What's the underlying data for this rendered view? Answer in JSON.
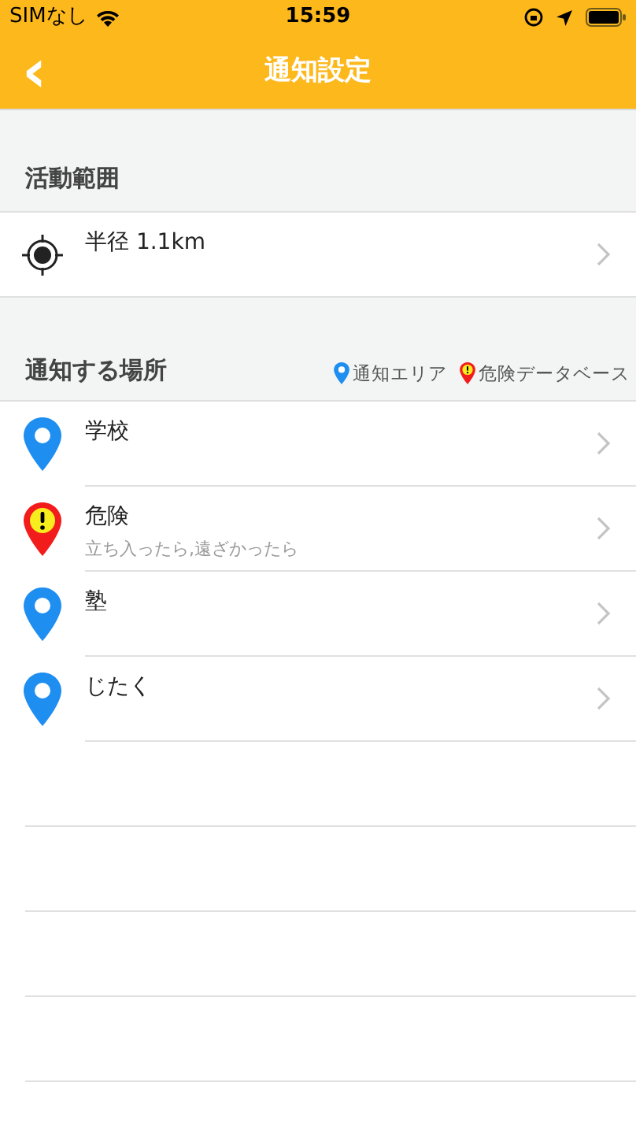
{
  "status_bar": {
    "carrier": "SIMなし",
    "time": "15:59"
  },
  "nav_bar": {
    "back": "‹",
    "title": "通知設定"
  },
  "activity_range": {
    "header": "活動範囲",
    "value": "半径 1.1km"
  },
  "places": {
    "header": "通知する場所",
    "legend": [
      {
        "kind": "area",
        "label": "通知エリア"
      },
      {
        "kind": "danger",
        "label": "危険データベース"
      }
    ],
    "items": [
      {
        "kind": "area",
        "title": "学校"
      },
      {
        "kind": "danger",
        "title": "危険",
        "subtitle": "立ち入ったら,遠ざかったら"
      },
      {
        "kind": "area",
        "title": "塾"
      },
      {
        "kind": "area",
        "title": "じたく"
      }
    ]
  }
}
